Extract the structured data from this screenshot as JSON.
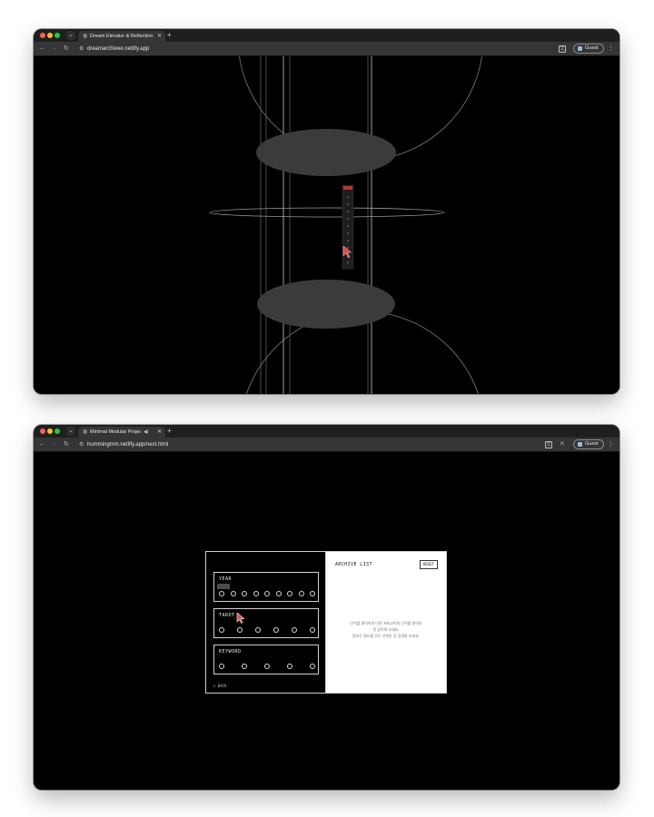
{
  "window1": {
    "tab_title": "Dream Elevator & Reflection",
    "url": "dreamarchivee.netlify.app",
    "guest_label": "Guest",
    "icons": {
      "tab_list": "chevron-down-icon",
      "favicon": "globe-icon",
      "close": "close-icon",
      "new_tab": "plus-icon",
      "back": "arrow-left-icon",
      "forward": "arrow-right-icon",
      "reload": "reload-icon",
      "site_info": "tune-icon",
      "translate": "translate-icon",
      "menu": "kebab-menu-icon",
      "cursor": "pointer-cursor-icon"
    },
    "colors": {
      "canvas": "#000000",
      "lines": "#8a8a8a",
      "ellipse_fill": "#3b3b3b",
      "cursor": "#e24848"
    }
  },
  "window2": {
    "tab_title": "Minimal Modular Project |",
    "url": "hummingmm.netlify.app/next.html",
    "guest_label": "Guest",
    "icons": {
      "favicon": "globe-icon",
      "audio": "speaker-icon",
      "close": "close-icon",
      "new_tab": "plus-icon",
      "translate": "translate-icon",
      "cast": "cast-icon",
      "menu": "kebab-menu-icon",
      "cursor": "pointer-cursor-icon"
    },
    "filters": [
      {
        "title": "YEAR",
        "count": 9
      },
      {
        "title": "TAROT",
        "count": 6
      },
      {
        "title": "KEYWORD",
        "count": 5
      }
    ],
    "back_label": "< BACK",
    "archive_title": "ARCHIVE LIST",
    "reset_label": "RESET",
    "note_lines": [
      "단어를 클릭하여 다른 카테고리와 단어를 클릭하",
      "면 꿈목록 보세요.",
      "원하는 필터를 모두 선택한 후 검색을 보세요."
    ],
    "colors": {
      "accent_cursor": "#e24848",
      "panel_right_bg": "#ffffff"
    }
  },
  "nav_icons": {
    "back": "←",
    "forward": "→",
    "reload": "C",
    "menu": "⋮"
  }
}
